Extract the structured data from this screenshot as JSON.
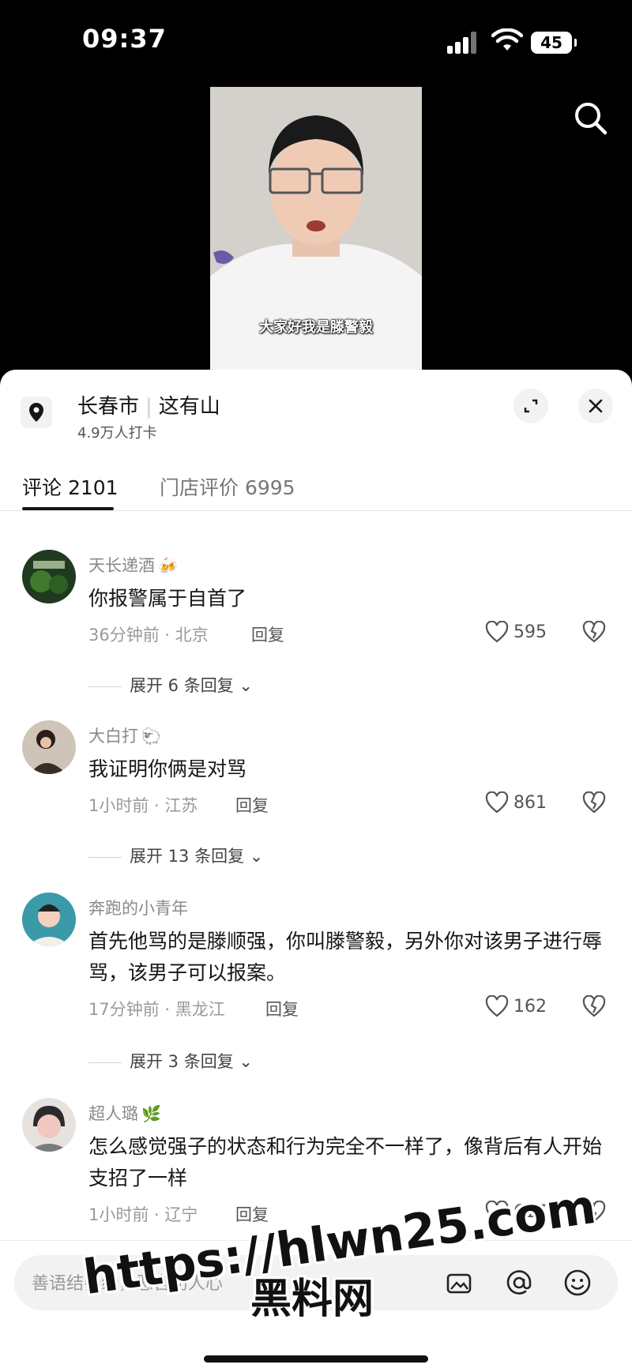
{
  "status_bar": {
    "time": "09:37",
    "battery": "45"
  },
  "video": {
    "subtitle": "大家好我是滕警毅"
  },
  "location": {
    "city": "长春市",
    "place": "这有山",
    "checkins": "4.9万人打卡"
  },
  "tabs": [
    {
      "label": "评论 2101",
      "active": true
    },
    {
      "label": "门店评价 6995",
      "active": false
    }
  ],
  "comments": [
    {
      "user": "天长递酒",
      "emoji": "🍻",
      "text": "你报警属于自首了",
      "meta": "36分钟前 · 北京",
      "reply_label": "回复",
      "likes": "595",
      "expand": "展开 6 条回复"
    },
    {
      "user": "大白打",
      "emoji": "🐑",
      "text": "我证明你俩是对骂",
      "meta": "1小时前 · 江苏",
      "reply_label": "回复",
      "likes": "861",
      "expand": "展开 13 条回复"
    },
    {
      "user": "奔跑的小青年",
      "emoji": "",
      "text": "首先他骂的是滕顺强，你叫滕警毅，另外你对该男子进行辱骂，该男子可以报案。",
      "meta": "17分钟前 · 黑龙江",
      "reply_label": "回复",
      "likes": "162",
      "expand": "展开 3 条回复"
    },
    {
      "user": "超人璐",
      "emoji": "🌿",
      "text": "怎么感觉强子的状态和行为完全不一样了，像背后有人开始支招了一样",
      "meta": "1小时前 · 辽宁",
      "reply_label": "回复",
      "likes": "617",
      "expand": ""
    }
  ],
  "input": {
    "placeholder": "善语结善缘，恶言伤人心"
  },
  "watermark": {
    "url": "https://hlwn25.com",
    "text": "黑料网"
  },
  "colors": {
    "text_primary": "#161616",
    "text_secondary": "#8a8a8a",
    "sheet_bg": "#ffffff",
    "app_bg": "#000000"
  }
}
